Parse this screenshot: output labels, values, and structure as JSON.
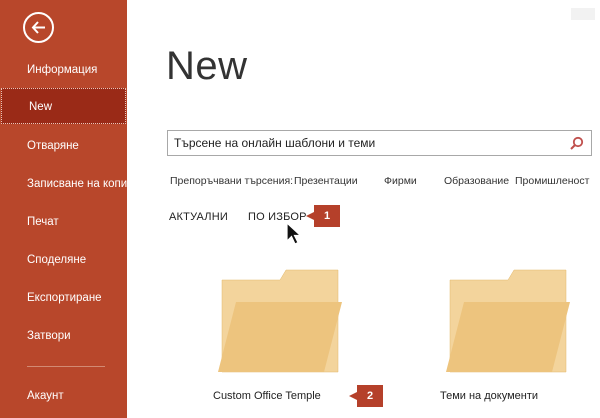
{
  "sidebar": {
    "back_label": "Back",
    "items": [
      {
        "label": "Информация"
      },
      {
        "label": "New"
      },
      {
        "label": "Отваряне"
      },
      {
        "label": "Записване на копие"
      },
      {
        "label": "Печат"
      },
      {
        "label": "Споделяне"
      },
      {
        "label": "Експортиране"
      },
      {
        "label": "Затвори"
      },
      {
        "label": "Акаунт"
      }
    ],
    "selected_index": 1
  },
  "main": {
    "title": "New",
    "search": {
      "value": "Търсене на онлайн шаблони и теми",
      "icon": "search-icon"
    },
    "suggested": {
      "label": "Препоръчвани търсения:",
      "items": [
        "Презентации",
        "Фирми",
        "Образование",
        "Промишленост"
      ]
    },
    "tabs": [
      {
        "label": "АКТУАЛНИ"
      },
      {
        "label": "ПО ИЗБОР",
        "callout": "1"
      }
    ],
    "folders": [
      {
        "label": "Custom Office Temple",
        "callout": "2"
      },
      {
        "label": "Теми на документи"
      }
    ]
  },
  "colors": {
    "sidebar": "#b8472b",
    "selected": "#9a2a17",
    "callout": "#b5402a",
    "folder_front": "#edc47e",
    "folder_back": "#f3d49c"
  }
}
